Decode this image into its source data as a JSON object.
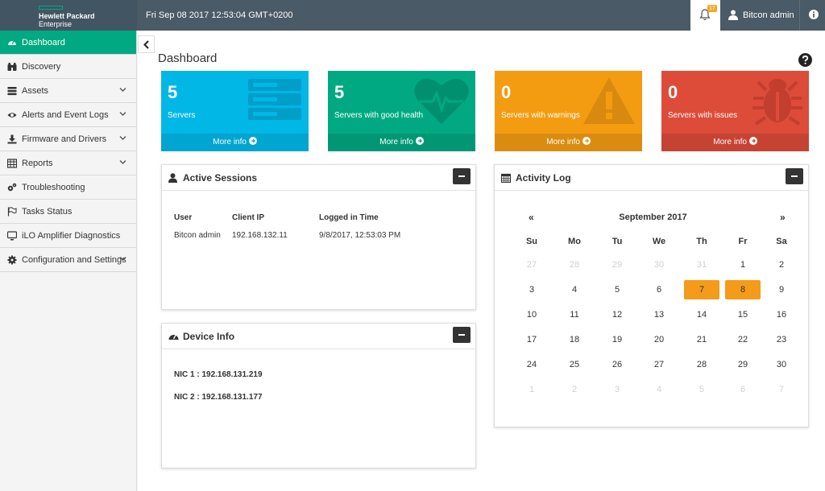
{
  "brand": {
    "line1": "Hewlett Packard",
    "line2": "Enterprise",
    "accent": "#01a982"
  },
  "header": {
    "datetime": "Fri Sep 08 2017 12:53:04 GMT+0200",
    "notification_count": "17",
    "user": "Bitcon admin"
  },
  "sidebar": {
    "items": [
      {
        "label": "Dashboard",
        "icon": "dashboard-icon",
        "active": true
      },
      {
        "label": "Discovery",
        "icon": "binoculars-icon"
      },
      {
        "label": "Assets",
        "icon": "server-icon",
        "expandable": true
      },
      {
        "label": "Alerts and Event Logs",
        "icon": "eye-icon",
        "expandable": true
      },
      {
        "label": "Firmware and Drivers",
        "icon": "download-icon",
        "expandable": true
      },
      {
        "label": "Reports",
        "icon": "table-icon",
        "expandable": true
      },
      {
        "label": "Troubleshooting",
        "icon": "cogs-icon"
      },
      {
        "label": "Tasks Status",
        "icon": "flag-icon"
      },
      {
        "label": "iLO Amplifier Diagnostics",
        "icon": "monitor-icon"
      },
      {
        "label": "Configuration and Settings",
        "icon": "gear-icon",
        "expandable": true
      }
    ]
  },
  "page": {
    "title": "Dashboard"
  },
  "tiles": [
    {
      "value": "5",
      "caption": "Servers",
      "more": "More info",
      "color": "#00b7e6",
      "footer_color": "#00a5d0",
      "icon": "server-stack-icon"
    },
    {
      "value": "5",
      "caption": "Servers with good health",
      "more": "More info",
      "color": "#01a982",
      "footer_color": "#019775",
      "icon": "heart-pulse-icon"
    },
    {
      "value": "0",
      "caption": "Servers with warnings",
      "more": "More info",
      "color": "#f39c12",
      "footer_color": "#da8c10",
      "icon": "warning-icon"
    },
    {
      "value": "0",
      "caption": "Servers with issues",
      "more": "More info",
      "color": "#dd4b39",
      "footer_color": "#c64333",
      "icon": "bug-icon"
    }
  ],
  "active_sessions": {
    "title": "Active Sessions",
    "columns": [
      "User",
      "Client IP",
      "Logged in Time"
    ],
    "rows": [
      [
        "Bitcon admin",
        "192.168.132.11",
        "9/8/2017, 12:53:03 PM"
      ]
    ]
  },
  "device_info": {
    "title": "Device Info",
    "nics": [
      "NIC 1 : 192.168.131.219",
      "NIC 2 : 192.168.131.177"
    ]
  },
  "activity_log": {
    "title": "Activity Log",
    "month": "September 2017",
    "prev": "«",
    "next": "»",
    "weekdays": [
      "Su",
      "Mo",
      "Tu",
      "We",
      "Th",
      "Fr",
      "Sa"
    ],
    "weeks": [
      [
        "27",
        "28",
        "29",
        "30",
        "31",
        "1",
        "2"
      ],
      [
        "3",
        "4",
        "5",
        "6",
        "7",
        "8",
        "9"
      ],
      [
        "10",
        "11",
        "12",
        "13",
        "14",
        "15",
        "16"
      ],
      [
        "17",
        "18",
        "19",
        "20",
        "21",
        "22",
        "23"
      ],
      [
        "24",
        "25",
        "26",
        "27",
        "28",
        "29",
        "30"
      ],
      [
        "1",
        "2",
        "3",
        "4",
        "5",
        "6",
        "7"
      ]
    ],
    "highlighted": [
      "7",
      "8"
    ],
    "highlight_color": "#f59b1a"
  }
}
